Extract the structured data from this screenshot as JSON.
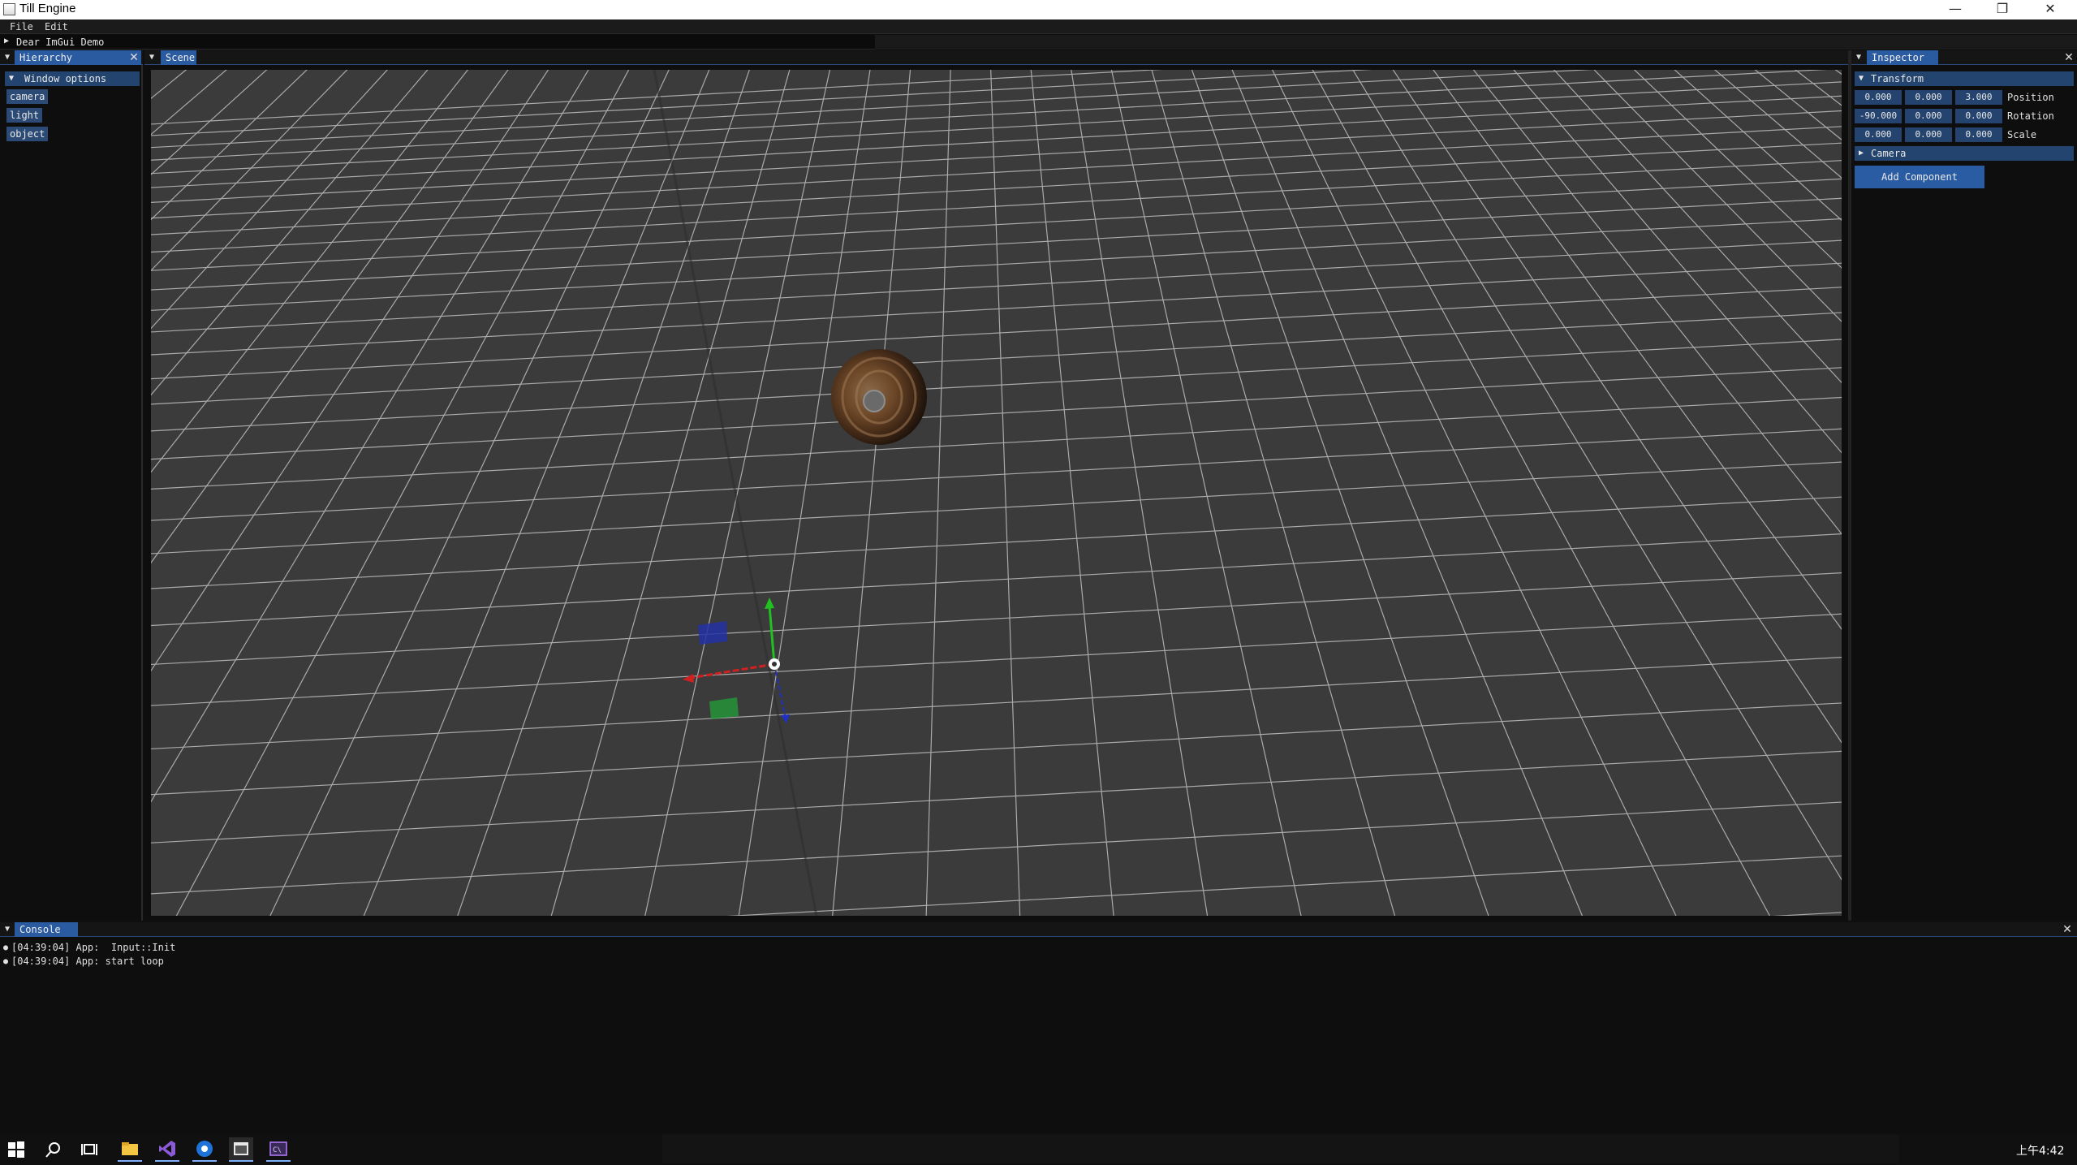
{
  "window": {
    "title": "Till Engine",
    "minimize": "—",
    "restore": "❐",
    "close": "✕"
  },
  "menu": {
    "items": [
      "File",
      "Edit"
    ]
  },
  "demo_window": {
    "label": "Dear ImGui Demo"
  },
  "hierarchy": {
    "tab": "Hierarchy",
    "section": "Window options",
    "items": [
      "camera",
      "light",
      "object"
    ]
  },
  "scene": {
    "tab": "Scene"
  },
  "inspector": {
    "tab": "Inspector",
    "transform_label": "Transform",
    "rows": [
      {
        "label": "Position",
        "values": [
          "0.000",
          "0.000",
          "3.000"
        ]
      },
      {
        "label": "Rotation",
        "values": [
          "-90.000",
          "0.000",
          "0.000"
        ]
      },
      {
        "label": "Scale",
        "values": [
          "0.000",
          "0.000",
          "0.000"
        ]
      }
    ],
    "camera_label": "Camera",
    "add_component": "Add Component"
  },
  "console": {
    "tab": "Console",
    "lines": [
      "[04:39:04] App:  Input::Init",
      "[04:39:04] App: start loop"
    ]
  },
  "taskbar": {
    "clock": "上午4:42"
  },
  "colors": {
    "accent": "#2a5aa0",
    "viewport": "#3b3b3b",
    "gizmo_x": "#d02020",
    "gizmo_y": "#20c020",
    "gizmo_z": "#2030c0"
  }
}
